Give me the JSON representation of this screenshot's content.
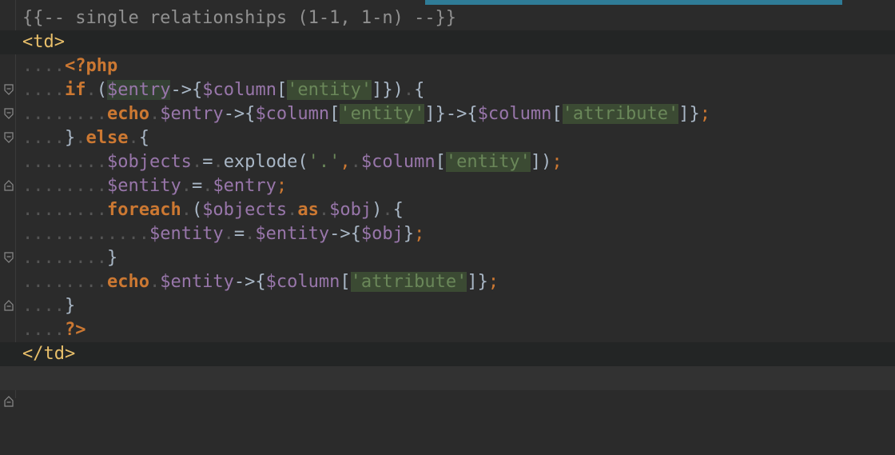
{
  "editor": {
    "language": "Blade/PHP",
    "accent_color": "#2f7c97",
    "background_color": "#2b2b2b"
  },
  "lines": [
    {
      "text": "{{-- single relationships (1-1, 1-n) --}}"
    },
    {
      "text": "<td>"
    },
    {
      "text": "<?php"
    },
    {
      "text": "if ($entry->{$column['entity']}) {"
    },
    {
      "text": "echo $entry->{$column['entity']}->{$column['attribute']};"
    },
    {
      "text": "} else {"
    },
    {
      "text": "$objects = explode('.', $column['entity']);"
    },
    {
      "text": "$entity = $entry;"
    },
    {
      "text": "foreach ($objects as $obj) {"
    },
    {
      "text": "$entity = $entity->{$obj};"
    },
    {
      "text": "}"
    },
    {
      "text": "echo $entity->{$column['attribute']};"
    },
    {
      "text": "}"
    },
    {
      "text": "?>"
    },
    {
      "text": "</td>"
    }
  ],
  "tokens": {
    "l0_comment": "{{-- single relationships (1-1, 1-n) --}}",
    "l1_tag": "<td>",
    "l2_php_open": "<?php",
    "kw_if": "if",
    "kw_echo": "echo",
    "kw_else": "else",
    "kw_foreach": "foreach",
    "kw_as": "as",
    "php_close": "?>",
    "td_close": "</td>",
    "var_entry": "$entry",
    "var_column": "$column",
    "var_objects": "$objects",
    "var_entity": "$entity",
    "var_obj": "$obj",
    "str_entity": "'entity'",
    "str_attribute": "'attribute'",
    "str_dot": "'.'",
    "fn_explode": "explode"
  }
}
